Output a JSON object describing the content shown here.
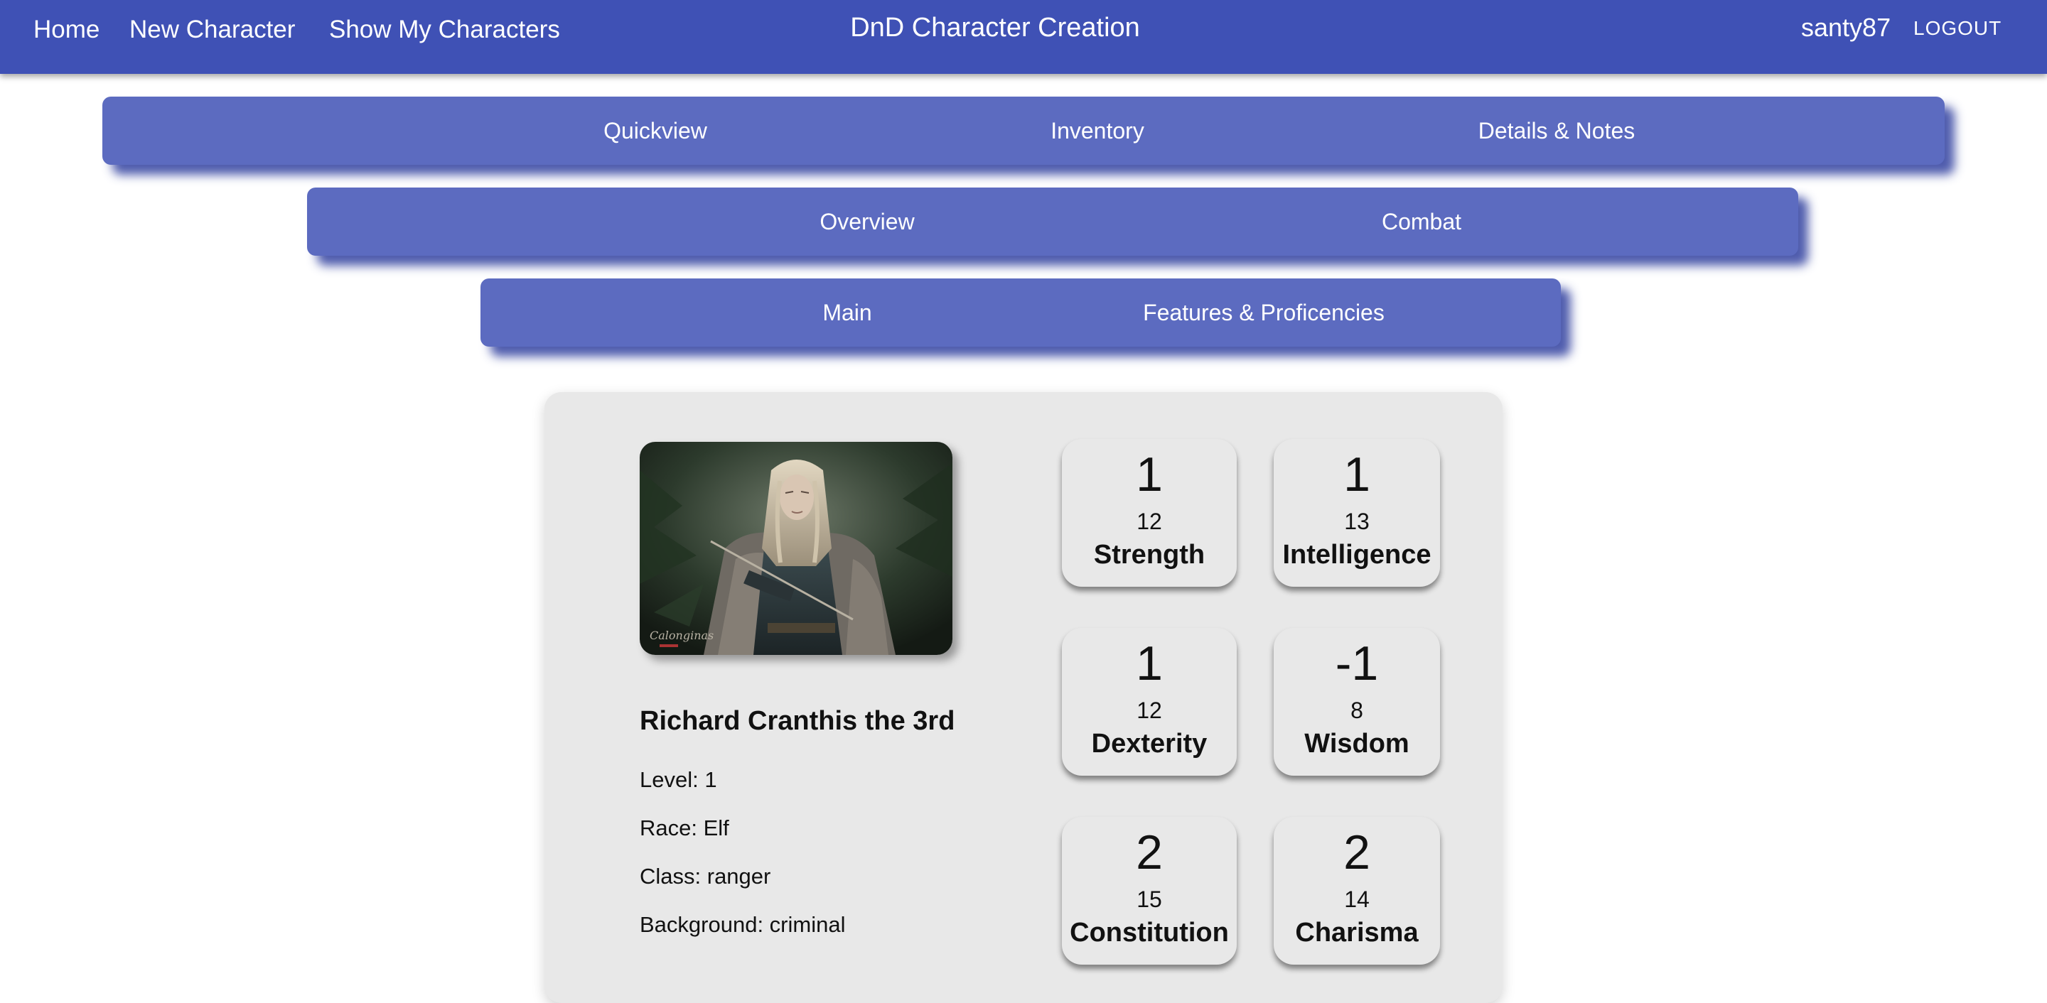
{
  "appbar": {
    "nav": {
      "home": "Home",
      "new_character": "New Character",
      "show_my_characters": "Show My Characters"
    },
    "title": "DnD Character Creation",
    "username": "santy87",
    "logout": "LOGOUT"
  },
  "tabs": {
    "primary": [
      "Quickview",
      "Inventory",
      "Details & Notes"
    ],
    "secondary": [
      "Overview",
      "Combat"
    ],
    "tertiary": [
      "Main",
      "Features & Proficencies"
    ]
  },
  "character": {
    "name": "Richard Cranthis the 3rd",
    "level": "Level: 1",
    "race": "Race: Elf",
    "class": "Class: ranger",
    "background": "Background: criminal",
    "portrait_watermark": "Calonginas"
  },
  "stats": {
    "strength": {
      "modifier": "1",
      "score": "12",
      "name": "Strength"
    },
    "intelligence": {
      "modifier": "1",
      "score": "13",
      "name": "Intelligence"
    },
    "dexterity": {
      "modifier": "1",
      "score": "12",
      "name": "Dexterity"
    },
    "wisdom": {
      "modifier": "-1",
      "score": "8",
      "name": "Wisdom"
    },
    "constitution": {
      "modifier": "2",
      "score": "15",
      "name": "Constitution"
    },
    "charisma": {
      "modifier": "2",
      "score": "14",
      "name": "Charisma"
    }
  },
  "colors": {
    "appbar": "#3f51b5",
    "tabbar": "#5c6bc0",
    "tab_shadow": "#303f9f",
    "card_background": "#e8e8e8"
  }
}
